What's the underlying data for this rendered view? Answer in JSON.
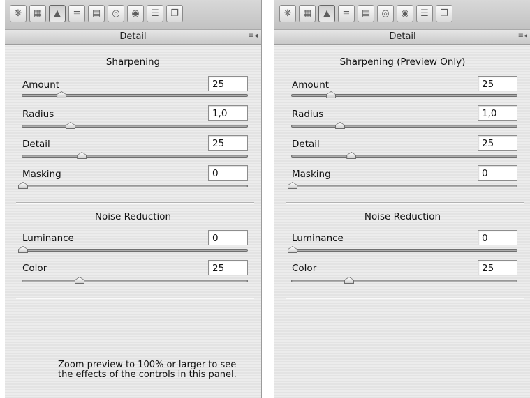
{
  "colors": {
    "panel_background": "#e8e8e8",
    "toolbar_background": "#cccccc",
    "slider_track": "#a0a0a0",
    "text": "#111111"
  },
  "panels": [
    {
      "tab_icons": [
        "aperture-icon",
        "tone-curve-icon",
        "detail-icon",
        "hsl-icon",
        "split-toning-icon",
        "lens-corrections-icon",
        "camera-calibration-icon",
        "presets-icon",
        "snapshots-icon"
      ],
      "active_tab": 2,
      "title": "Detail",
      "sharpening": {
        "heading": "Sharpening",
        "amount": {
          "label": "Amount",
          "value": "25",
          "level": 0.17
        },
        "radius": {
          "label": "Radius",
          "value": "1,0",
          "level": 0.21
        },
        "detail": {
          "label": "Detail",
          "value": "25",
          "level": 0.26
        },
        "masking": {
          "label": "Masking",
          "value": "0",
          "level": 0.0
        }
      },
      "noise_reduction": {
        "heading": "Noise Reduction",
        "luminance": {
          "label": "Luminance",
          "value": "0",
          "level": 0.0
        },
        "color": {
          "label": "Color",
          "value": "25",
          "level": 0.25
        }
      },
      "note": "Zoom preview to 100% or larger to see the effects of the controls in this panel."
    },
    {
      "tab_icons": [
        "aperture-icon",
        "tone-curve-icon",
        "detail-icon",
        "hsl-icon",
        "split-toning-icon",
        "lens-corrections-icon",
        "camera-calibration-icon",
        "presets-icon",
        "snapshots-icon"
      ],
      "active_tab": 2,
      "title": "Detail",
      "sharpening": {
        "heading": "Sharpening  (Preview Only)",
        "amount": {
          "label": "Amount",
          "value": "25",
          "level": 0.17
        },
        "radius": {
          "label": "Radius",
          "value": "1,0",
          "level": 0.21
        },
        "detail": {
          "label": "Detail",
          "value": "25",
          "level": 0.26
        },
        "masking": {
          "label": "Masking",
          "value": "0",
          "level": 0.0
        }
      },
      "noise_reduction": {
        "heading": "Noise Reduction",
        "luminance": {
          "label": "Luminance",
          "value": "0",
          "level": 0.0
        },
        "color": {
          "label": "Color",
          "value": "25",
          "level": 0.25
        }
      }
    }
  ]
}
